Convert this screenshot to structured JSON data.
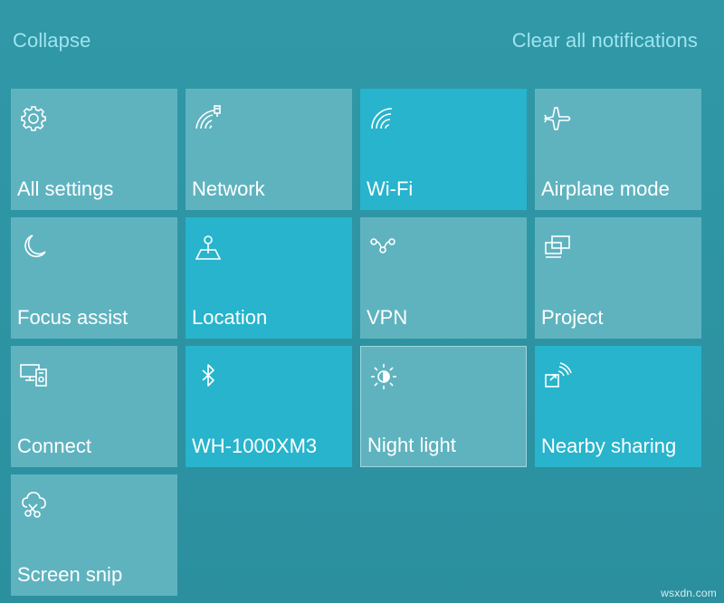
{
  "header": {
    "collapse_label": "Collapse",
    "clear_label": "Clear all notifications"
  },
  "tiles": [
    {
      "label": "All settings",
      "icon": "gear-icon",
      "state": "off"
    },
    {
      "label": "Network",
      "icon": "network-icon",
      "state": "off"
    },
    {
      "label": "Wi-Fi",
      "icon": "wifi-icon",
      "state": "on"
    },
    {
      "label": "Airplane mode",
      "icon": "airplane-icon",
      "state": "off"
    },
    {
      "label": "Focus assist",
      "icon": "moon-icon",
      "state": "off"
    },
    {
      "label": "Location",
      "icon": "location-icon",
      "state": "on"
    },
    {
      "label": "VPN",
      "icon": "vpn-icon",
      "state": "off"
    },
    {
      "label": "Project",
      "icon": "project-icon",
      "state": "off"
    },
    {
      "label": "Connect",
      "icon": "connect-icon",
      "state": "off"
    },
    {
      "label": "WH-1000XM3",
      "icon": "bluetooth-icon",
      "state": "on"
    },
    {
      "label": "Night light",
      "icon": "sun-icon",
      "state": "off"
    },
    {
      "label": "Nearby sharing",
      "icon": "nearby-sharing-icon",
      "state": "on"
    },
    {
      "label": "Screen snip",
      "icon": "screen-snip-icon",
      "state": "off"
    }
  ],
  "watermark": "wsxdn.com",
  "colors": {
    "background": "#2f97a6",
    "tile_off": "#5fb3bf",
    "tile_on": "#27b4cc",
    "link": "#9ee4ef"
  }
}
